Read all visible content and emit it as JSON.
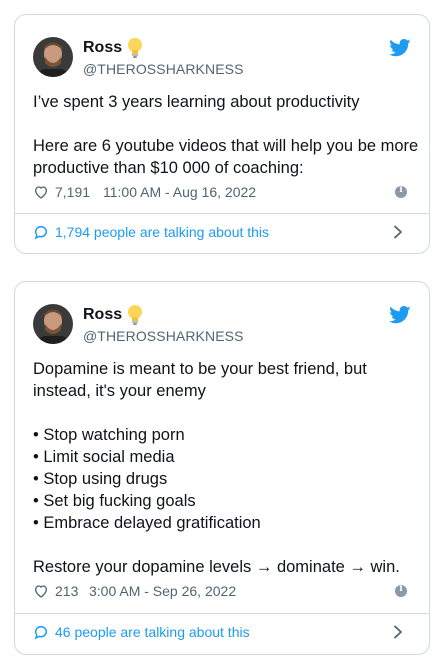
{
  "tweets": [
    {
      "author": "Ross",
      "handle": "@THEROSSHARKNESS",
      "lines": [
        "I’ve spent 3 years learning about productivity",
        "",
        "Here are 6 youtube videos that will help you be more",
        "productive than $10 000 of coaching:"
      ],
      "likes": "7,191",
      "timestamp": "11:00 AM - Aug 16, 2022",
      "talking": "1,794 people are talking about this"
    },
    {
      "author": "Ross",
      "handle": "@THEROSSHARKNESS",
      "lines": [
        "Dopamine is meant to be your best friend, but",
        "instead, it's your enemy",
        "",
        "• Stop watching porn",
        "• Limit social media",
        "• Stop using drugs",
        "• Set big fucking goals",
        "• Embrace delayed gratification",
        "",
        "Restore your dopamine levels → dominate → win."
      ],
      "likes": "213",
      "timestamp": "3:00 AM - Sep 26, 2022",
      "talking": "46 people are talking about this"
    }
  ],
  "colors": {
    "accent": "#1d9bf0",
    "border": "#cfd9de",
    "secondary_text": "#536471"
  },
  "icons": {
    "badge": "lightbulb-icon",
    "brand": "twitter-bird-icon",
    "like": "heart-outline-icon",
    "reply": "speech-bubble-icon",
    "info": "info-icon",
    "navigate": "chevron-right-icon"
  }
}
